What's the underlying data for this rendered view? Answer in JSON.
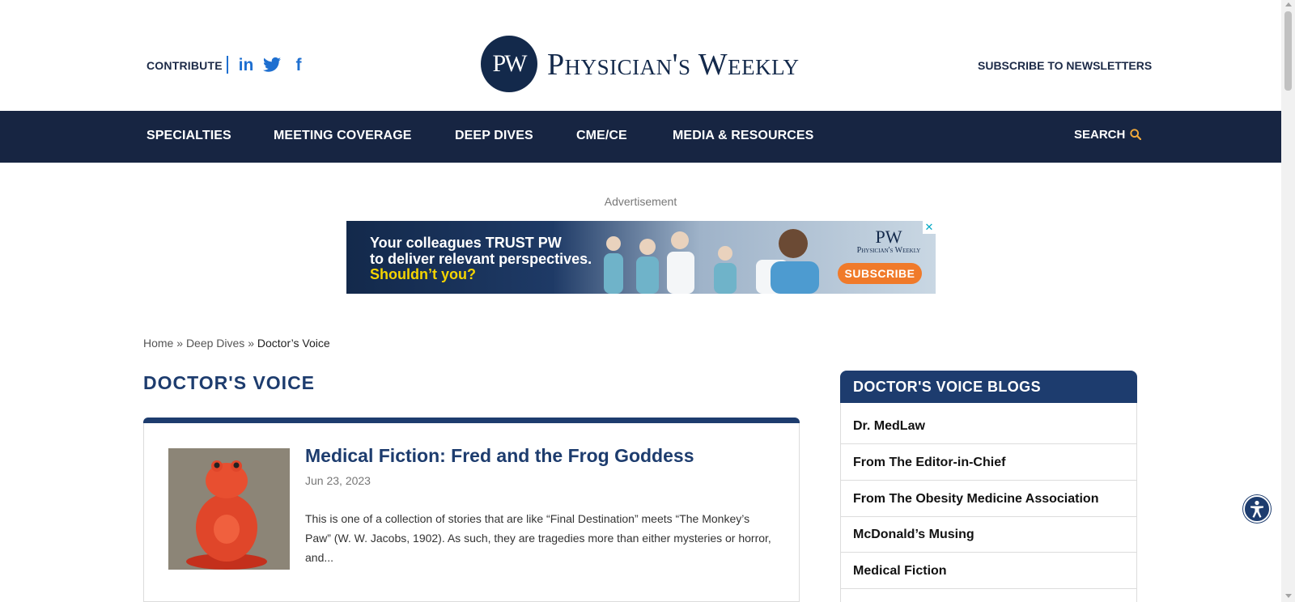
{
  "header": {
    "contribute_label": "CONTRIBUTE",
    "social": [
      {
        "icon": "linkedin-icon",
        "glyph": "in"
      },
      {
        "icon": "twitter-icon",
        "glyph": "🐦"
      },
      {
        "icon": "facebook-icon",
        "glyph": "f"
      }
    ],
    "logo_mark": "PW",
    "logo_text": "Physician's Weekly",
    "subscribe_label": "SUBSCRIBE TO NEWSLETTERS"
  },
  "nav": {
    "items": [
      "SPECIALTIES",
      "MEETING COVERAGE",
      "DEEP DIVES",
      "CME/CE",
      "MEDIA & RESOURCES"
    ],
    "search_label": "SEARCH",
    "search_icon": "search-icon"
  },
  "ad": {
    "label": "Advertisement",
    "line1": "Your colleagues TRUST PW",
    "line2": "to deliver relevant perspectives.",
    "line3": "Shouldn’t you?",
    "logo_mark": "PW",
    "logo_name": "Physician's Weekly",
    "button": "SUBSCRIBE",
    "close": "✕"
  },
  "breadcrumb": {
    "home": "Home",
    "sep1": "»",
    "deep_dives": "Deep Dives",
    "sep2": "»",
    "current": "Doctor’s Voice"
  },
  "page_title": "DOCTOR'S VOICE",
  "article": {
    "title": "Medical Fiction: Fred and the Frog Goddess",
    "date": "Jun 23, 2023",
    "excerpt": "This is one of a collection of stories that are like “Final Destination” meets “The Monkey’s Paw” (W. W. Jacobs, 1902). As such, they are tragedies more than either mysteries or horror, and..."
  },
  "sidebar": {
    "title": "DOCTOR'S VOICE BLOGS",
    "items": [
      "Dr. MedLaw",
      "From The Editor-in-Chief",
      "From The Obesity Medicine Association",
      "McDonald’s Musing",
      "Medical Fiction"
    ]
  },
  "colors": {
    "navy": "#172542",
    "title_blue": "#1d3c6e",
    "link_blue": "#1e6fd0",
    "accent_orange": "#f07a2a",
    "ad_yellow": "#f5d400"
  }
}
